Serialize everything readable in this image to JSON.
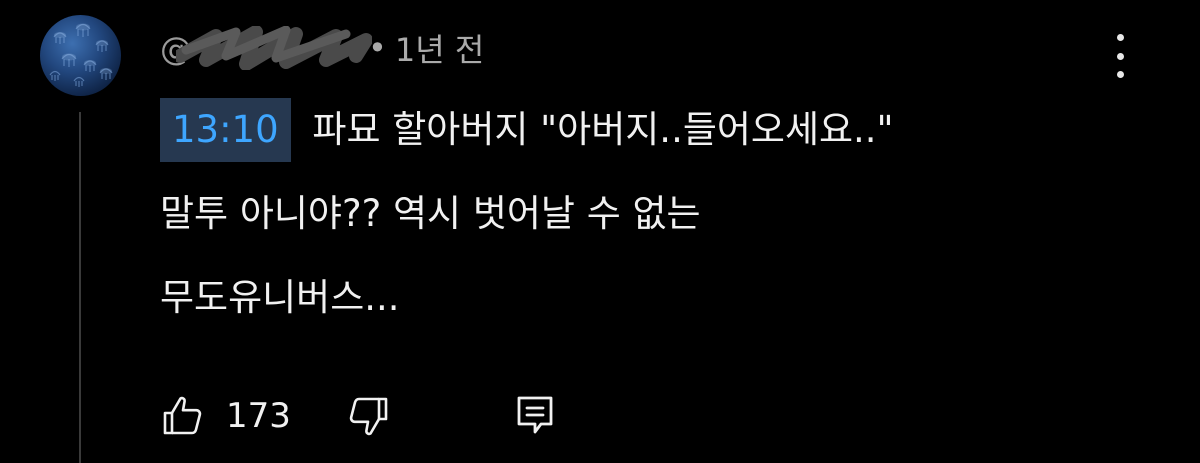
{
  "comment": {
    "author_handle": "@",
    "separator": "•",
    "time_ago": "1년 전",
    "timestamp_link": "13:10",
    "body_line1_rest": " 파묘 할아버지 \"아버지..들어오세요..\"",
    "body_line2": "말투 아니야?? 역시 벗어날 수 없는",
    "body_line3": "무도유니버스...",
    "like_count": "173",
    "icons": {
      "menu": "kebab-menu-icon",
      "like": "thumbs-up-icon",
      "dislike": "thumbs-down-icon",
      "reply": "reply-comment-icon"
    }
  },
  "colors": {
    "background": "#000000",
    "text_primary": "#f1f1f1",
    "text_secondary": "#aaaaaa",
    "timestamp_text": "#3ea6ff",
    "timestamp_bg": "#263850"
  }
}
